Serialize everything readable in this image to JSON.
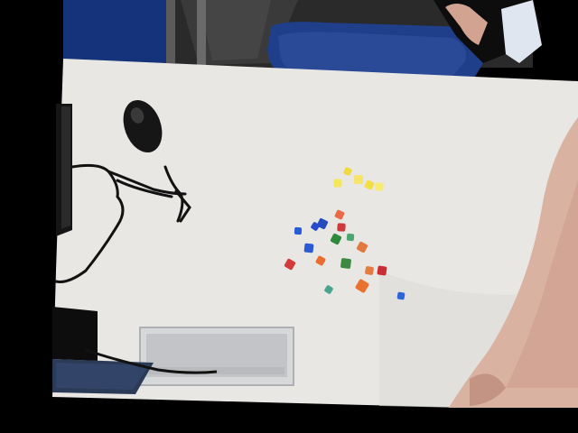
{
  "scene": {
    "kind": "overhead camera photo",
    "colors": {
      "background": "#000000",
      "floor": "#3a3a3a",
      "chair": "#1f3f8a",
      "table": "#e9e7e3",
      "table_shadow": "#d8d6d1",
      "keyboard": "#111111",
      "mouse": "#1a1a1a",
      "cable": "#121212",
      "tray": "#c8c9cb",
      "laptop": "#2a3a57",
      "skin": "#d9b2a2",
      "skin_dark": "#b98676"
    },
    "pieces": [
      {
        "color": "#f5e75a"
      },
      {
        "color": "#f0d93f"
      },
      {
        "color": "#f7e46a"
      },
      {
        "color": "#f2df44"
      },
      {
        "color": "#f7eb74"
      },
      {
        "color": "#e96a44"
      },
      {
        "color": "#2a5bd6"
      },
      {
        "color": "#244bc0"
      },
      {
        "color": "#cf3b3b"
      },
      {
        "color": "#2e8a3a"
      },
      {
        "color": "#4aa56f"
      },
      {
        "color": "#e07a3f"
      },
      {
        "color": "#2a59d4"
      },
      {
        "color": "#e86d2f"
      },
      {
        "color": "#3b8a3f"
      },
      {
        "color": "#d33b3b"
      },
      {
        "color": "#c92e34"
      },
      {
        "color": "#e9722f"
      },
      {
        "color": "#2b66d8"
      },
      {
        "color": "#48a58d"
      },
      {
        "color": "#e57b3f"
      },
      {
        "color": "#234bcb"
      }
    ]
  }
}
